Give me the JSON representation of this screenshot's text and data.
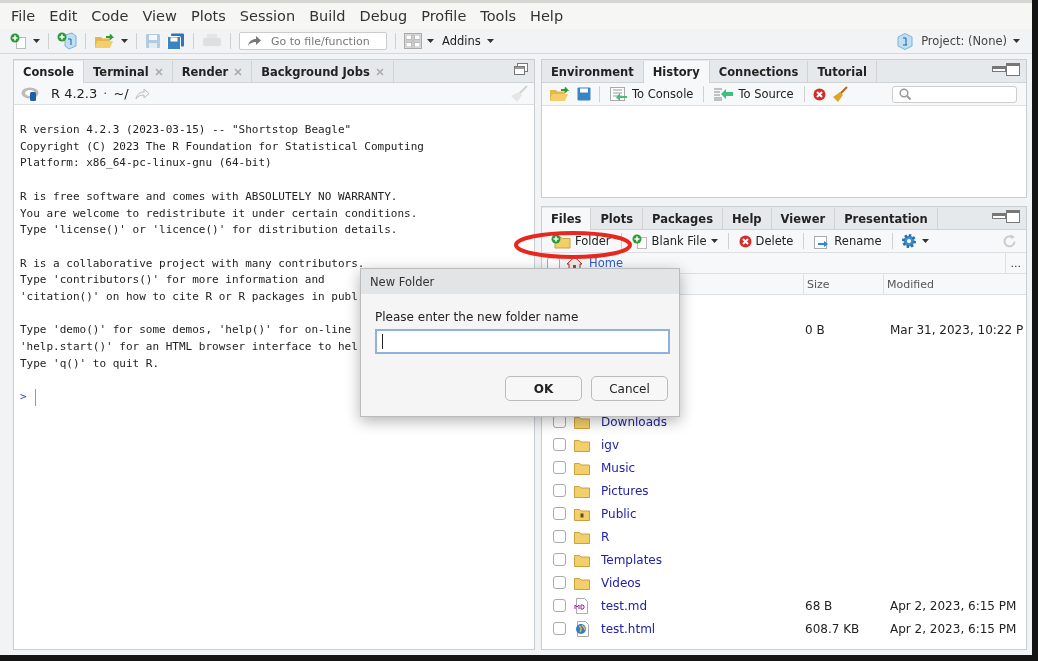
{
  "menu": [
    "File",
    "Edit",
    "Code",
    "View",
    "Plots",
    "Session",
    "Build",
    "Debug",
    "Profile",
    "Tools",
    "Help"
  ],
  "toolbar": {
    "goto_placeholder": "Go to file/function",
    "addins": "Addins",
    "project": "Project: (None)"
  },
  "console": {
    "tabs": [
      {
        "label": "Console",
        "selected": true,
        "closable": false
      },
      {
        "label": "Terminal",
        "selected": false,
        "closable": true
      },
      {
        "label": "Render",
        "selected": false,
        "closable": true
      },
      {
        "label": "Background Jobs",
        "selected": false,
        "closable": true
      }
    ],
    "r_version": "R 4.2.3",
    "separator": "·",
    "path": "~/",
    "paragraphs": [
      [
        "R version 4.2.3 (2023-03-15) -- \"Shortstop Beagle\"",
        "Copyright (C) 2023 The R Foundation for Statistical Computing",
        "Platform: x86_64-pc-linux-gnu (64-bit)"
      ],
      [
        "R is free software and comes with ABSOLUTELY NO WARRANTY.",
        "You are welcome to redistribute it under certain conditions.",
        "Type 'license()' or 'licence()' for distribution details."
      ],
      [
        "R is a collaborative project with many contributors.",
        "Type 'contributors()' for more information and",
        "'citation()' on how to cite R or R packages in publ"
      ],
      [
        "Type 'demo()' for some demos, 'help()' for on-line",
        "'help.start()' for an HTML browser interface to hel",
        "Type 'q()' to quit R."
      ]
    ],
    "prompt": ">"
  },
  "env_pane": {
    "tabs": [
      {
        "label": "Environment",
        "selected": false
      },
      {
        "label": "History",
        "selected": true
      },
      {
        "label": "Connections",
        "selected": false
      },
      {
        "label": "Tutorial",
        "selected": false
      }
    ],
    "buttons": [
      {
        "label": "To Console",
        "kind": "console"
      },
      {
        "label": "To Source",
        "kind": "source"
      }
    ]
  },
  "files_pane": {
    "tabs": [
      {
        "label": "Files",
        "selected": true
      },
      {
        "label": "Plots",
        "selected": false
      },
      {
        "label": "Packages",
        "selected": false
      },
      {
        "label": "Help",
        "selected": false
      },
      {
        "label": "Viewer",
        "selected": false
      },
      {
        "label": "Presentation",
        "selected": false
      }
    ],
    "buttons": [
      {
        "label": "Folder",
        "kind": "folder",
        "dropdown": false
      },
      {
        "label": "Blank File",
        "kind": "blank",
        "dropdown": true
      },
      {
        "label": "Delete",
        "kind": "delete",
        "dropdown": false
      },
      {
        "label": "Rename",
        "kind": "rename",
        "dropdown": false
      }
    ],
    "path": "Home",
    "path_checked": false,
    "overflow": "...",
    "columns": [
      "Size",
      "Modified"
    ],
    "rows": [
      {
        "kind": "file",
        "size": "0 B",
        "modified": "Mar 31, 2023, 10:22 P"
      },
      {
        "kind": "folder",
        "checked": false,
        "name": "Downloads"
      },
      {
        "kind": "folder",
        "checked": false,
        "name": "igv"
      },
      {
        "kind": "folder",
        "checked": false,
        "name": "Music"
      },
      {
        "kind": "folder",
        "checked": false,
        "name": "Pictures"
      },
      {
        "kind": "public",
        "checked": false,
        "name": "Public"
      },
      {
        "kind": "folder",
        "checked": false,
        "name": "R"
      },
      {
        "kind": "folder",
        "checked": false,
        "name": "Templates"
      },
      {
        "kind": "folder",
        "checked": false,
        "name": "Videos"
      },
      {
        "kind": "markdown",
        "checked": false,
        "name": "test.md",
        "size": "68 B",
        "modified": "Apr 2, 2023, 6:15 PM"
      },
      {
        "kind": "html",
        "checked": false,
        "name": "test.html",
        "size": "608.7 KB",
        "modified": "Apr 2, 2023, 6:15 PM"
      }
    ]
  },
  "dialog": {
    "title": "New Folder",
    "label": "Please enter the new folder name",
    "buttons": [
      {
        "label": "OK",
        "default": true
      },
      {
        "label": "Cancel",
        "default": false
      }
    ]
  }
}
